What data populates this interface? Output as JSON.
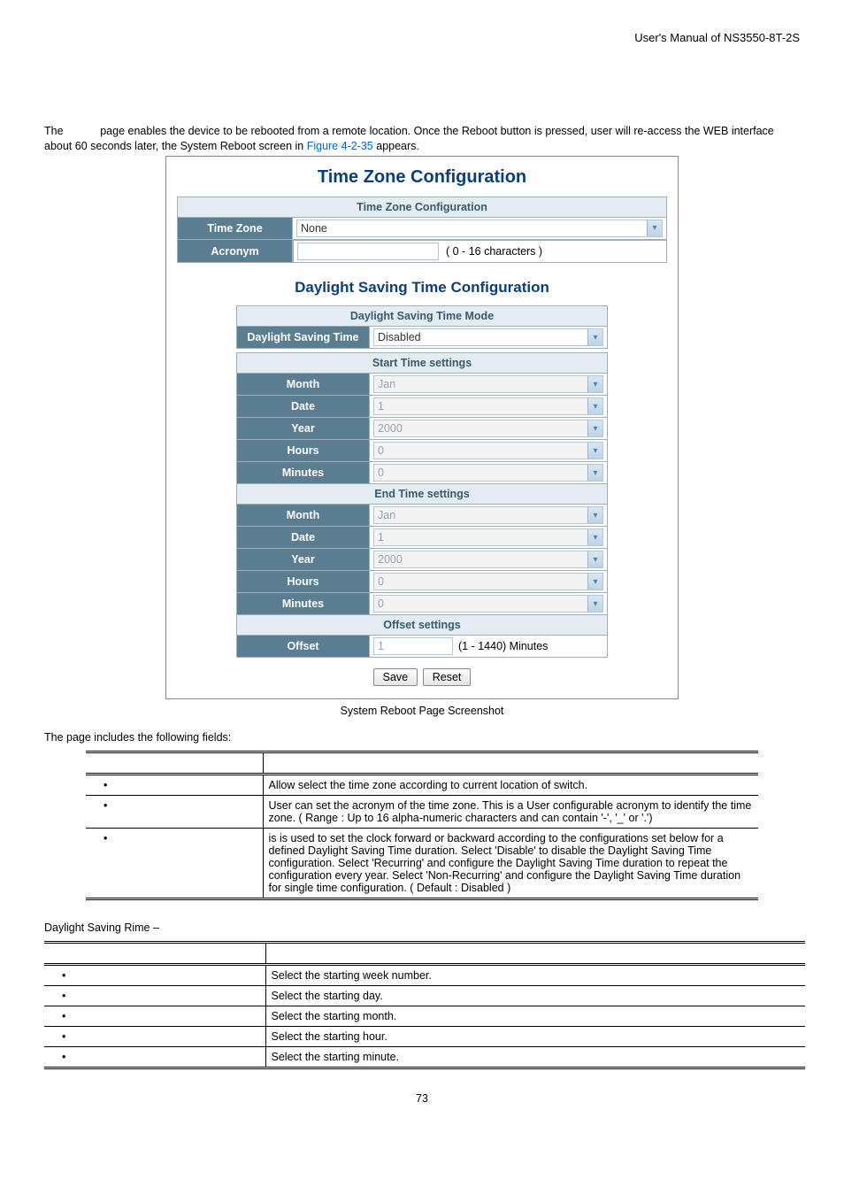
{
  "header": {
    "doc_title": "User's Manual of NS3550-8T-2S"
  },
  "intro": {
    "p1_a": "The",
    "p1_b": "page enables the device to be rebooted from a remote location. Once the Reboot button is pressed, user will re-access the WEB interface about 60 seconds later, the System Reboot screen in ",
    "link": "Figure 4-2-35",
    "p1_c": " appears."
  },
  "screenshot": {
    "tz_title": "Time Zone Configuration",
    "tz_section": "Time Zone Configuration",
    "tz_label": "Time Zone",
    "tz_value": "None",
    "acr_label": "Acronym",
    "acr_hint": "( 0 - 16 characters )",
    "dst_title": "Daylight Saving Time Configuration",
    "dst_mode_section": "Daylight Saving Time Mode",
    "dst_label": "Daylight Saving Time",
    "dst_value": "Disabled",
    "start_section": "Start Time settings",
    "end_section": "End Time settings",
    "rows": {
      "month": "Month",
      "date": "Date",
      "year": "Year",
      "hours": "Hours",
      "minutes": "Minutes"
    },
    "start": {
      "month": "Jan",
      "date": "1",
      "year": "2000",
      "hours": "0",
      "minutes": "0"
    },
    "end": {
      "month": "Jan",
      "date": "1",
      "year": "2000",
      "hours": "0",
      "minutes": "0"
    },
    "offset_section": "Offset settings",
    "offset_label": "Offset",
    "offset_value": "1",
    "offset_hint": "(1 - 1440) Minutes",
    "save": "Save",
    "reset": "Reset"
  },
  "caption": "System Reboot Page Screenshot",
  "fields_intro": "The page includes the following fields:",
  "table1": {
    "rows": [
      {
        "desc": "Allow select the time zone according to current location of switch."
      },
      {
        "desc": "User can set the acronym of the time zone. This is a User configurable acronym to identify the time zone. ( Range : Up to 16 alpha-numeric characters and can contain '-', '_' or '.')"
      },
      {
        "desc": "is is used to set the clock forward or backward according to the configurations set below for a defined Daylight Saving Time duration. Select 'Disable' to disable the Daylight Saving Time configuration. Select 'Recurring' and configure the Daylight Saving Time duration to repeat the configuration every year. Select 'Non-Recurring' and configure the Daylight Saving Time duration for single time configuration. ( Default : Disabled )"
      }
    ]
  },
  "subheader": "Daylight Saving Rime –",
  "table2": {
    "rows": [
      {
        "desc": "Select the starting week number."
      },
      {
        "desc": "Select the starting day."
      },
      {
        "desc": "Select the starting month."
      },
      {
        "desc": "Select the starting hour."
      },
      {
        "desc": "Select the starting minute."
      }
    ]
  },
  "page_number": "73"
}
